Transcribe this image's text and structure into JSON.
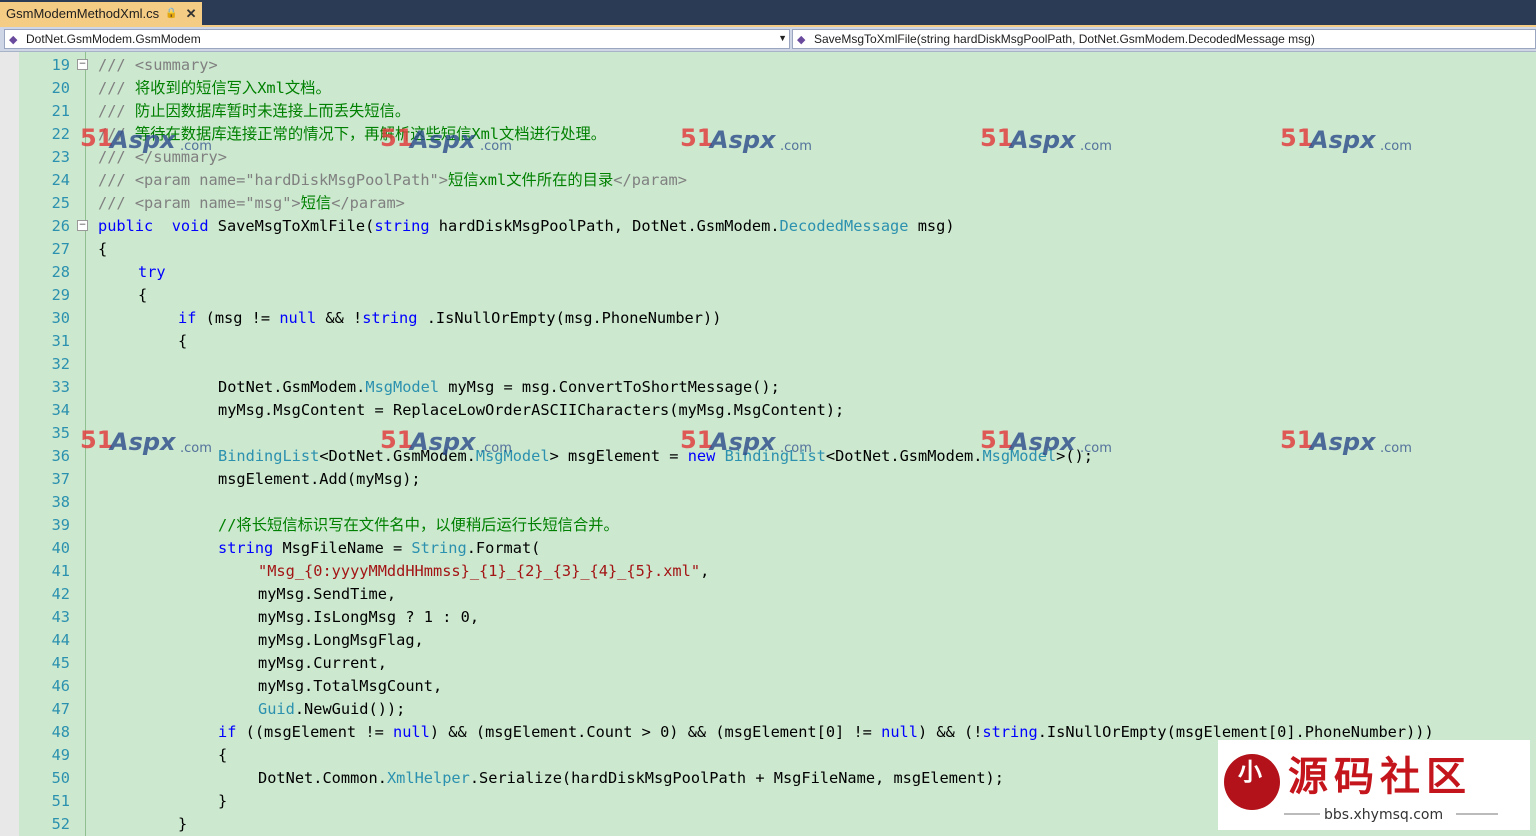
{
  "tab": {
    "title": "GsmModemMethodXml.cs",
    "lock_icon": "lock-icon",
    "close_icon": "close-icon"
  },
  "nav": {
    "left_combo": "DotNet.GsmModem.GsmModem",
    "right_combo": "SaveMsgToXmlFile(string hardDiskMsgPoolPath, DotNet.GsmModem.DecodedMessage msg)"
  },
  "watermark": {
    "num": "51",
    "brand": "Aspx",
    "suffix": ".com"
  },
  "logo": {
    "chars": "小猪",
    "title": "源码社区",
    "url": "bbs.xhymsq.com"
  },
  "colors": {
    "editor_bg": "#cce8cf",
    "keyword": "#0000ff",
    "type": "#2b91af",
    "string": "#a31515",
    "comment": "#008000",
    "tab_active": "#f5cc84"
  },
  "code_lines": [
    {
      "n": "19",
      "fold": "⊟",
      "indent": 0,
      "parts": [
        [
          "xd",
          "/// <summary>"
        ]
      ]
    },
    {
      "n": "20",
      "indent": 0,
      "parts": [
        [
          "xd",
          "/// "
        ],
        [
          "cm",
          "将收到的短信写入Xml文档。"
        ]
      ]
    },
    {
      "n": "21",
      "indent": 0,
      "parts": [
        [
          "xd",
          "/// "
        ],
        [
          "cm",
          "防止因数据库暂时未连接上而丢失短信。"
        ]
      ]
    },
    {
      "n": "22",
      "indent": 0,
      "parts": [
        [
          "xd",
          "/// "
        ],
        [
          "cm",
          "等待在数据库连接正常的情况下，再解析这些短信Xml文档进行处理。"
        ]
      ]
    },
    {
      "n": "23",
      "indent": 0,
      "parts": [
        [
          "xd",
          "/// </summary>"
        ]
      ]
    },
    {
      "n": "24",
      "indent": 0,
      "parts": [
        [
          "xd",
          "/// <param name=\"hardDiskMsgPoolPath\">"
        ],
        [
          "cm",
          "短信xml文件所在的目录"
        ],
        [
          "xd",
          "</param>"
        ]
      ]
    },
    {
      "n": "25",
      "indent": 0,
      "parts": [
        [
          "xd",
          "/// <param name=\"msg\">"
        ],
        [
          "cm",
          "短信"
        ],
        [
          "xd",
          "</param>"
        ]
      ]
    },
    {
      "n": "26",
      "fold": "⊟",
      "indent": 0,
      "parts": [
        [
          "kw",
          "public"
        ],
        [
          "",
          "  "
        ],
        [
          "kw",
          "void"
        ],
        [
          "",
          " SaveMsgToXmlFile("
        ],
        [
          "kw",
          "string"
        ],
        [
          "",
          " hardDiskMsgPoolPath, DotNet.GsmModem."
        ],
        [
          "ty",
          "DecodedMessage"
        ],
        [
          "",
          " msg)"
        ]
      ]
    },
    {
      "n": "27",
      "indent": 0,
      "parts": [
        [
          "",
          "{"
        ]
      ]
    },
    {
      "n": "28",
      "indent": 1,
      "parts": [
        [
          "kw",
          "try"
        ]
      ]
    },
    {
      "n": "29",
      "indent": 1,
      "parts": [
        [
          "",
          "{"
        ]
      ]
    },
    {
      "n": "30",
      "indent": 2,
      "parts": [
        [
          "kw",
          "if"
        ],
        [
          "",
          " (msg != "
        ],
        [
          "kw",
          "null"
        ],
        [
          "",
          " && !"
        ],
        [
          "kw",
          "string"
        ],
        [
          "",
          " .IsNullOrEmpty(msg.PhoneNumber))"
        ]
      ]
    },
    {
      "n": "31",
      "indent": 2,
      "parts": [
        [
          "",
          "{"
        ]
      ]
    },
    {
      "n": "32",
      "indent": 0,
      "parts": []
    },
    {
      "n": "33",
      "indent": 3,
      "parts": [
        [
          "",
          "DotNet.GsmModem."
        ],
        [
          "ty",
          "MsgModel"
        ],
        [
          "",
          " myMsg = msg.ConvertToShortMessage();"
        ]
      ]
    },
    {
      "n": "34",
      "indent": 3,
      "parts": [
        [
          "",
          "myMsg.MsgContent = ReplaceLowOrderASCIICharacters(myMsg.MsgContent);"
        ]
      ]
    },
    {
      "n": "35",
      "indent": 0,
      "parts": []
    },
    {
      "n": "36",
      "indent": 3,
      "parts": [
        [
          "ty",
          "BindingList"
        ],
        [
          "",
          "<DotNet.GsmModem."
        ],
        [
          "ty",
          "MsgModel"
        ],
        [
          "",
          "> msgElement = "
        ],
        [
          "kw",
          "new"
        ],
        [
          "",
          " "
        ],
        [
          "ty",
          "BindingList"
        ],
        [
          "",
          "<DotNet.GsmModem."
        ],
        [
          "ty",
          "MsgModel"
        ],
        [
          "",
          ">();"
        ]
      ]
    },
    {
      "n": "37",
      "indent": 3,
      "parts": [
        [
          "",
          "msgElement.Add(myMsg);"
        ]
      ]
    },
    {
      "n": "38",
      "indent": 0,
      "parts": []
    },
    {
      "n": "39",
      "indent": 3,
      "parts": [
        [
          "cm",
          "//将长短信标识写在文件名中，以便稍后运行长短信合并。"
        ]
      ]
    },
    {
      "n": "40",
      "indent": 3,
      "parts": [
        [
          "kw",
          "string"
        ],
        [
          "",
          " MsgFileName = "
        ],
        [
          "ty",
          "String"
        ],
        [
          "",
          ".Format("
        ]
      ]
    },
    {
      "n": "41",
      "indent": 4,
      "parts": [
        [
          "str",
          "\"Msg_{0:yyyyMMddHHmmss}_{1}_{2}_{3}_{4}_{5}.xml\""
        ],
        [
          "",
          ","
        ]
      ]
    },
    {
      "n": "42",
      "indent": 4,
      "parts": [
        [
          "",
          "myMsg.SendTime,"
        ]
      ]
    },
    {
      "n": "43",
      "indent": 4,
      "parts": [
        [
          "",
          "myMsg.IsLongMsg ? 1 : 0,"
        ]
      ]
    },
    {
      "n": "44",
      "indent": 4,
      "parts": [
        [
          "",
          "myMsg.LongMsgFlag,"
        ]
      ]
    },
    {
      "n": "45",
      "indent": 4,
      "parts": [
        [
          "",
          "myMsg.Current,"
        ]
      ]
    },
    {
      "n": "46",
      "indent": 4,
      "parts": [
        [
          "",
          "myMsg.TotalMsgCount,"
        ]
      ]
    },
    {
      "n": "47",
      "indent": 4,
      "parts": [
        [
          "ty",
          "Guid"
        ],
        [
          "",
          ".NewGuid());"
        ]
      ]
    },
    {
      "n": "48",
      "indent": 3,
      "parts": [
        [
          "kw",
          "if"
        ],
        [
          "",
          " ((msgElement != "
        ],
        [
          "kw",
          "null"
        ],
        [
          "",
          ") && (msgElement.Count > 0) && (msgElement[0] != "
        ],
        [
          "kw",
          "null"
        ],
        [
          "",
          ") && (!"
        ],
        [
          "kw",
          "string"
        ],
        [
          "",
          ".IsNullOrEmpty(msgElement[0].PhoneNumber)))"
        ]
      ]
    },
    {
      "n": "49",
      "indent": 3,
      "parts": [
        [
          "",
          "{"
        ]
      ]
    },
    {
      "n": "50",
      "indent": 4,
      "parts": [
        [
          "",
          "DotNet.Common."
        ],
        [
          "ty",
          "XmlHelper"
        ],
        [
          "",
          ".Serialize(hardDiskMsgPoolPath + MsgFileName, msgElement);"
        ]
      ]
    },
    {
      "n": "51",
      "indent": 3,
      "parts": [
        [
          "",
          "}"
        ]
      ]
    },
    {
      "n": "52",
      "indent": 2,
      "parts": [
        [
          "",
          "}"
        ]
      ]
    }
  ]
}
